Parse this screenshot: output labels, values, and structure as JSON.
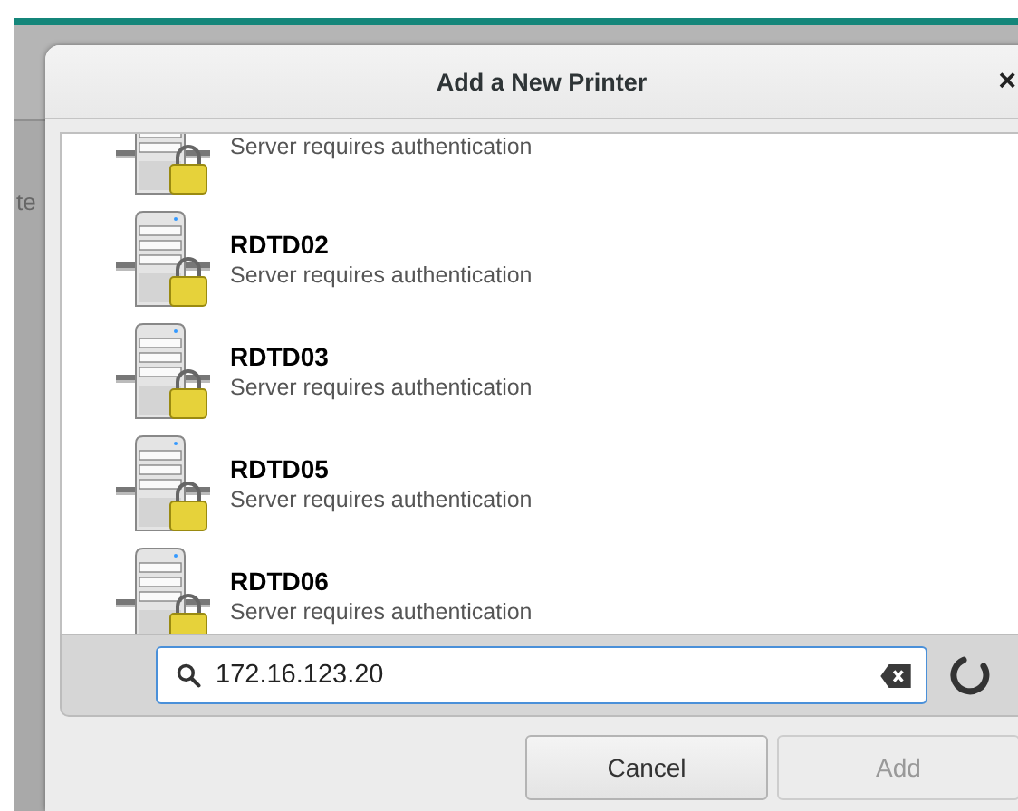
{
  "background_app": {
    "label": "te"
  },
  "dialog": {
    "title": "Add a New Printer",
    "close": "×"
  },
  "printers": [
    {
      "status": "Server requires authentication",
      "locked": true
    },
    {
      "name": "RDTD02",
      "status": "Server requires authentication",
      "locked": true
    },
    {
      "name": "RDTD03",
      "status": "Server requires authentication",
      "locked": true
    },
    {
      "name": "RDTD05",
      "status": "Server requires authentication",
      "locked": true
    },
    {
      "name": "RDTD06",
      "status": "Server requires authentication",
      "locked": true
    }
  ],
  "search": {
    "value": "172.16.123.20",
    "busy": true
  },
  "buttons": [
    {
      "label": "Cancel",
      "disabled": false
    },
    {
      "label": "Add",
      "disabled": true
    }
  ]
}
